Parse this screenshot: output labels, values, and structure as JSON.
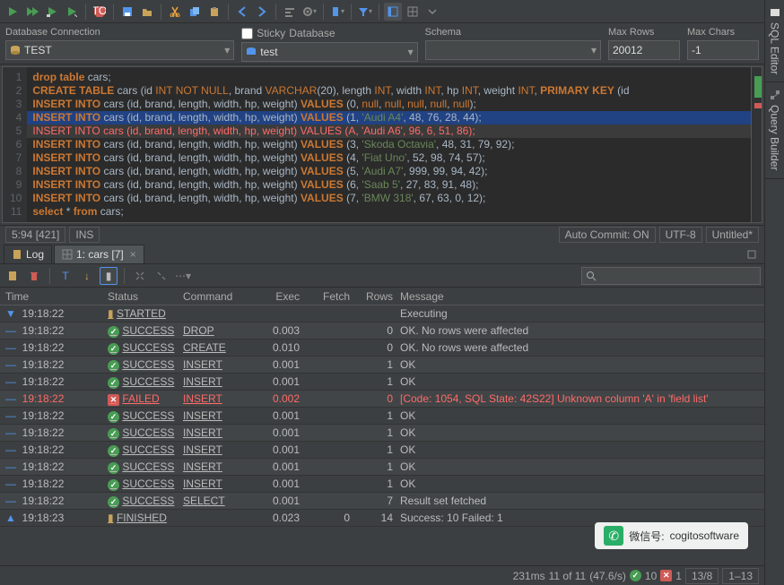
{
  "connection": {
    "conn_label": "Database Connection",
    "conn_value": "TEST",
    "sticky_label": "Sticky",
    "db_label": "Database",
    "db_value": "test",
    "schema_label": "Schema",
    "schema_value": "",
    "maxrows_label": "Max Rows",
    "maxrows_value": "20012",
    "maxchars_label": "Max Chars",
    "maxchars_value": "-1"
  },
  "sql_lines": [
    {
      "n": 1,
      "type": "drop"
    },
    {
      "n": 2,
      "type": "create"
    },
    {
      "n": 3,
      "type": "insert",
      "vals": "(0, null, null, null, null, null);"
    },
    {
      "n": 4,
      "type": "insert",
      "vals": "(1, 'Audi A4', 48, 76, 28, 44);",
      "hi": true
    },
    {
      "n": 5,
      "type": "insert",
      "vals": "(A, 'Audi A6', 96, 6, 51, 86);",
      "err": true
    },
    {
      "n": 6,
      "type": "insert",
      "vals": "(3, 'Skoda Octavia', 48, 31, 79, 92);"
    },
    {
      "n": 7,
      "type": "insert",
      "vals": "(4, 'Fiat Uno', 52, 98, 74, 57);"
    },
    {
      "n": 8,
      "type": "insert",
      "vals": "(5, 'Audi A7', 999, 99, 94, 42);"
    },
    {
      "n": 9,
      "type": "insert",
      "vals": "(6, 'Saab 5', 27, 83, 91, 48);"
    },
    {
      "n": 10,
      "type": "insert",
      "vals": "(7, 'BMW 318', 67, 63, 0, 12);"
    },
    {
      "n": 11,
      "type": "select"
    }
  ],
  "status1": {
    "pos": "5:94 [421]",
    "ins": "INS",
    "autocommit": "Auto Commit: ON",
    "encoding": "UTF-8",
    "file": "Untitled*"
  },
  "tabs": {
    "log": "Log",
    "cars": "1: cars [7]"
  },
  "log": {
    "headers": {
      "time": "Time",
      "status": "Status",
      "command": "Command",
      "exec": "Exec",
      "fetch": "Fetch",
      "rows": "Rows",
      "message": "Message"
    },
    "rows": [
      {
        "arrow": "down",
        "time": "19:18:22",
        "status": "STARTED",
        "icon": "start",
        "cmd": "",
        "exec": "",
        "fetch": "",
        "rows": "",
        "msg": "Executing"
      },
      {
        "arrow": "right",
        "time": "19:18:22",
        "status": "SUCCESS",
        "icon": "ok",
        "cmd": "DROP",
        "exec": "0.003",
        "fetch": "",
        "rows": "0",
        "msg": "OK. No rows were affected"
      },
      {
        "arrow": "right",
        "time": "19:18:22",
        "status": "SUCCESS",
        "icon": "ok",
        "cmd": "CREATE",
        "exec": "0.010",
        "fetch": "",
        "rows": "0",
        "msg": "OK. No rows were affected"
      },
      {
        "arrow": "right",
        "time": "19:18:22",
        "status": "SUCCESS",
        "icon": "ok",
        "cmd": "INSERT",
        "exec": "0.001",
        "fetch": "",
        "rows": "1",
        "msg": "OK"
      },
      {
        "arrow": "right",
        "time": "19:18:22",
        "status": "SUCCESS",
        "icon": "ok",
        "cmd": "INSERT",
        "exec": "0.001",
        "fetch": "",
        "rows": "1",
        "msg": "OK"
      },
      {
        "arrow": "right",
        "time": "19:18:22",
        "status": "FAILED",
        "icon": "err",
        "cmd": "INSERT",
        "exec": "0.002",
        "fetch": "",
        "rows": "0",
        "msg": "[Code: 1054, SQL State: 42S22]  Unknown column 'A' in 'field list'",
        "iserr": true
      },
      {
        "arrow": "right",
        "time": "19:18:22",
        "status": "SUCCESS",
        "icon": "ok",
        "cmd": "INSERT",
        "exec": "0.001",
        "fetch": "",
        "rows": "1",
        "msg": "OK"
      },
      {
        "arrow": "right",
        "time": "19:18:22",
        "status": "SUCCESS",
        "icon": "ok",
        "cmd": "INSERT",
        "exec": "0.001",
        "fetch": "",
        "rows": "1",
        "msg": "OK"
      },
      {
        "arrow": "right",
        "time": "19:18:22",
        "status": "SUCCESS",
        "icon": "ok",
        "cmd": "INSERT",
        "exec": "0.001",
        "fetch": "",
        "rows": "1",
        "msg": "OK"
      },
      {
        "arrow": "right",
        "time": "19:18:22",
        "status": "SUCCESS",
        "icon": "ok",
        "cmd": "INSERT",
        "exec": "0.001",
        "fetch": "",
        "rows": "1",
        "msg": "OK"
      },
      {
        "arrow": "right",
        "time": "19:18:22",
        "status": "SUCCESS",
        "icon": "ok",
        "cmd": "INSERT",
        "exec": "0.001",
        "fetch": "",
        "rows": "1",
        "msg": "OK"
      },
      {
        "arrow": "right",
        "time": "19:18:22",
        "status": "SUCCESS",
        "icon": "ok",
        "cmd": "SELECT",
        "exec": "0.001",
        "fetch": "",
        "rows": "7",
        "msg": "Result set fetched"
      },
      {
        "arrow": "up",
        "time": "19:18:23",
        "status": "FINISHED",
        "icon": "fin",
        "cmd": "",
        "exec": "0.023",
        "fetch": "0",
        "rows": "14",
        "msg": "Success: 10 Failed: 1"
      }
    ]
  },
  "bottom": {
    "time": "231ms",
    "prog": "11 of 11",
    "rate": "(47.6/s)",
    "ok": "10",
    "fail": "1",
    "pos1": "13/8",
    "pos2": "1–13"
  },
  "sidebars": {
    "sql": "SQL Editor",
    "qb": "Query Builder"
  },
  "wm": {
    "label": "微信号:",
    "id": "cogitosoftware"
  }
}
